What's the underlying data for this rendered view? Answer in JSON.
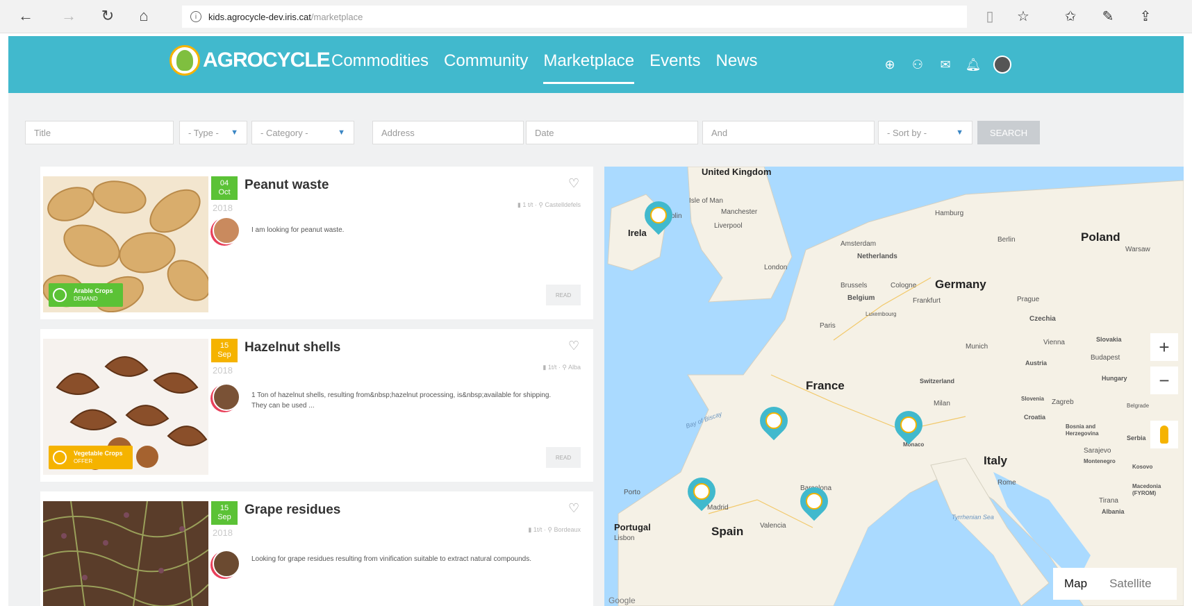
{
  "browser": {
    "url_host": "kids.agrocycle-dev.iris.cat",
    "url_path": "/marketplace"
  },
  "header": {
    "logo_text": "AGROCYCLE",
    "nav": [
      "Commodities",
      "Community",
      "Marketplace",
      "Events",
      "News"
    ],
    "active_nav": "Marketplace"
  },
  "filters": {
    "title_placeholder": "Title",
    "type_label": "- Type -",
    "category_label": "- Category -",
    "address_placeholder": "Address",
    "date_placeholder": "Date",
    "and_placeholder": "And",
    "sort_label": "- Sort by -",
    "search_label": "SEARCH"
  },
  "listings": [
    {
      "day": "04",
      "month": "Oct",
      "year": "2018",
      "title": "Peanut waste",
      "date_color": "#5bc236",
      "badge_label": "Arable Crops",
      "badge_sub": "DEMAND",
      "badge_color": "#5bc236",
      "meta_qty": "1 t/t",
      "meta_location": "Castelldefels",
      "description": "I am looking for peanut waste.",
      "read_label": "READ"
    },
    {
      "day": "15",
      "month": "Sep",
      "year": "2018",
      "title": "Hazelnut shells",
      "date_color": "#f5b300",
      "badge_label": "Vegetable Crops",
      "badge_sub": "OFFER",
      "badge_color": "#f5b300",
      "meta_qty": "1t/t",
      "meta_location": "Alba",
      "description": "1 Ton of hazelnut shells, resulting from&nbsp;hazelnut processing, is&nbsp;available for shipping. They can be used ...",
      "read_label": "READ"
    },
    {
      "day": "15",
      "month": "Sep",
      "year": "2018",
      "title": "Grape residues",
      "date_color": "#5bc236",
      "meta_qty": "1t/t",
      "meta_location": "Bordeaux",
      "description": "Looking for grape residues resulting from vinification suitable to extract natural compounds."
    }
  ],
  "map": {
    "labels": {
      "uk": "United Kingdom",
      "isle_of_man": "Isle of Man",
      "manchester": "Manchester",
      "liverpool": "Liverpool",
      "ireland": "Irela",
      "dublin": "blin",
      "london": "London",
      "amsterdam": "Amsterdam",
      "netherlands": "Netherlands",
      "hamburg": "Hamburg",
      "berlin": "Berlin",
      "poland": "Poland",
      "warsaw": "Warsaw",
      "brussels": "Brussels",
      "cologne": "Cologne",
      "germany": "Germany",
      "belgium": "Belgium",
      "frankfurt": "Frankfurt",
      "luxembourg": "Luxembourg",
      "prague": "Prague",
      "czechia": "Czechia",
      "paris": "Paris",
      "munich": "Munich",
      "vienna": "Vienna",
      "slovakia": "Slovakia",
      "budapest": "Budapest",
      "austria": "Austria",
      "hungary": "Hungary",
      "france": "France",
      "switzerland": "Switzerland",
      "milan": "Milan",
      "slovenia": "Slovenia",
      "zagreb": "Zagreb",
      "croatia": "Croatia",
      "belgrade": "Belgrade",
      "bosnia": "Bosnia and Herzegovina",
      "serbia": "Serbia",
      "bay_of_biscay": "Bay of Biscay",
      "monaco": "Monaco",
      "italy": "Italy",
      "sarajevo": "Sarajevo",
      "montenegro": "Montenegro",
      "kosovo": "Kosovo",
      "rome": "Rome",
      "macedonia": "Macedonia (FYROM)",
      "tirana": "Tirana",
      "albania": "Albania",
      "porto": "Porto",
      "madrid": "Madrid",
      "portugal": "Portugal",
      "lisbon": "Lisbon",
      "spain": "Spain",
      "valencia": "Valencia",
      "barcelona": "Barcelona",
      "tyrrhenian": "Tyrrhenian Sea",
      "google": "Google"
    },
    "zoom_in": "+",
    "zoom_out": "−",
    "type_map": "Map",
    "type_satellite": "Satellite"
  }
}
